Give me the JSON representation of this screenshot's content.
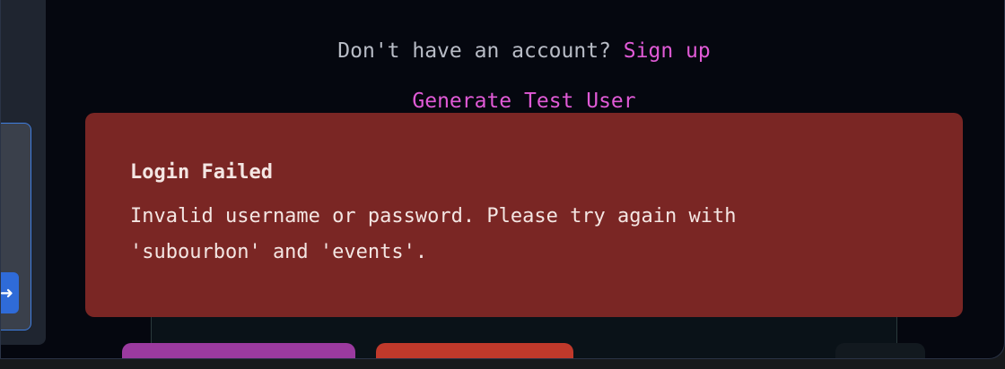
{
  "auth": {
    "signup_prompt": "Don't have an account?",
    "signup_link": "Sign up",
    "generate_test_user": "Generate Test User"
  },
  "toast": {
    "title": "Login Failed",
    "message": "Invalid username or password. Please try again with 'subourbon' and 'events'."
  },
  "side": {
    "send_icon": "arrow-right-icon"
  },
  "colors": {
    "link": "#e05ad6",
    "toast_bg": "#7a2624",
    "window_bg": "#05070f",
    "side_accent": "#3f7ee0"
  }
}
